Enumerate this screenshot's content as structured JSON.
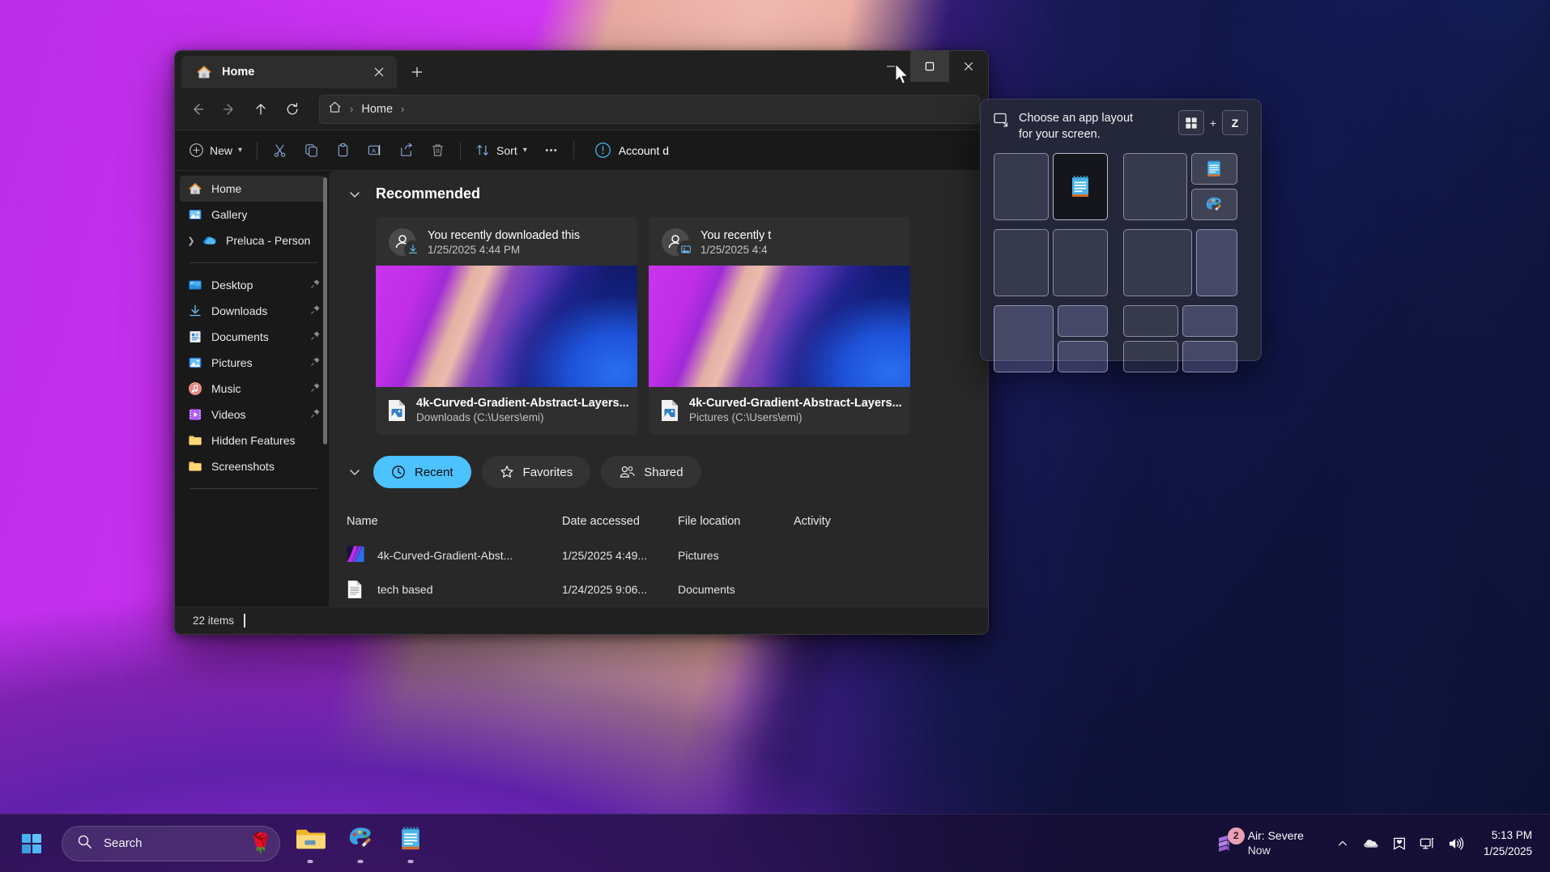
{
  "window": {
    "tab": {
      "label": "Home",
      "icon": "home-icon",
      "close_icon": "close-icon"
    },
    "new_tab_icon": "plus-icon",
    "controls": {
      "minimize": "minimize-icon",
      "maximize": "maximize-icon",
      "close": "close-icon"
    }
  },
  "address": {
    "back_icon": "arrow-left-icon",
    "forward_icon": "arrow-right-icon",
    "up_icon": "arrow-up-icon",
    "refresh_icon": "refresh-icon",
    "home_icon": "home-outline-icon",
    "crumb": "Home",
    "sep": "›"
  },
  "toolbar": {
    "new_label": "New",
    "new_icon": "plus-circle-icon",
    "cut_icon": "scissors-icon",
    "copy_icon": "copy-icon",
    "paste_icon": "clipboard-icon",
    "rename_icon": "rename-icon",
    "share_icon": "share-icon",
    "delete_icon": "trash-icon",
    "sort_label": "Sort",
    "sort_icon": "sort-icon",
    "more_icon": "ellipsis-icon",
    "account_label": "Account d",
    "account_icon": "alert-circle-icon",
    "chevron": "ˇ"
  },
  "sidebar": {
    "items": [
      {
        "label": "Home",
        "icon": "home-icon",
        "selected": true,
        "pinned": false,
        "expandable": false
      },
      {
        "label": "Gallery",
        "icon": "gallery-icon",
        "selected": false,
        "pinned": false,
        "expandable": false
      },
      {
        "label": "Preluca - Person",
        "icon": "onedrive-icon",
        "selected": false,
        "pinned": false,
        "expandable": true
      }
    ],
    "folders": [
      {
        "label": "Desktop",
        "icon": "desktop-icon",
        "pinned": true
      },
      {
        "label": "Downloads",
        "icon": "download-icon",
        "pinned": true
      },
      {
        "label": "Documents",
        "icon": "documents-icon",
        "pinned": true
      },
      {
        "label": "Pictures",
        "icon": "pictures-icon",
        "pinned": true
      },
      {
        "label": "Music",
        "icon": "music-icon",
        "pinned": true
      },
      {
        "label": "Videos",
        "icon": "videos-icon",
        "pinned": true
      },
      {
        "label": "Hidden Features",
        "icon": "folder-icon",
        "pinned": false
      },
      {
        "label": "Screenshots",
        "icon": "folder-icon",
        "pinned": false
      }
    ],
    "pin_icon": "pin-icon"
  },
  "recommended": {
    "title": "Recommended",
    "chevron": "⌄",
    "cards": [
      {
        "headline": "You recently downloaded this",
        "timestamp": "1/25/2025 4:44 PM",
        "filename": "4k-Curved-Gradient-Abstract-Layers...",
        "location": "Downloads (C:\\Users\\emi)",
        "badge_icon": "download-icon",
        "avatar_icon": "person-icon",
        "file_icon": "image-file-icon"
      },
      {
        "headline": "You recently t",
        "timestamp": "1/25/2025 4:4",
        "filename": "4k-Curved-Gradient-Abstract-Layers...",
        "location": "Pictures (C:\\Users\\emi)",
        "badge_icon": "image-icon",
        "avatar_icon": "person-icon",
        "file_icon": "image-file-icon"
      }
    ]
  },
  "quickaccess": {
    "chevron": "⌄",
    "tabs": [
      {
        "label": "Recent",
        "icon": "clock-icon",
        "active": true
      },
      {
        "label": "Favorites",
        "icon": "star-icon",
        "active": false
      },
      {
        "label": "Shared",
        "icon": "people-icon",
        "active": false
      }
    ],
    "columns": [
      "Name",
      "Date accessed",
      "File location",
      "Activity"
    ],
    "rows": [
      {
        "name": "4k-Curved-Gradient-Abst...",
        "date": "1/25/2025 4:49...",
        "location": "Pictures",
        "activity": "",
        "icon": "gradient-thumb-icon"
      },
      {
        "name": "tech based",
        "date": "1/24/2025 9:06...",
        "location": "Documents",
        "activity": "",
        "icon": "text-file-icon"
      }
    ]
  },
  "statusbar": {
    "items_count": "22 items"
  },
  "snap_layout": {
    "icon": "snap-layout-icon",
    "text_line1": "Choose an app layout",
    "text_line2": "for your screen.",
    "shortcut_key1": "windows-key-icon",
    "shortcut_plus": "+",
    "shortcut_key2": "Z",
    "notepad_icon": "notepad-icon",
    "paint_icon": "paint-icon"
  },
  "taskbar": {
    "start_icon": "windows-start-icon",
    "search": {
      "placeholder": "Search",
      "icon": "search-icon",
      "deco": "🌹"
    },
    "apps": [
      {
        "name": "file-explorer",
        "icon": "folder-icon",
        "running": true
      },
      {
        "name": "paint",
        "icon": "paint-icon",
        "running": true
      },
      {
        "name": "notepad",
        "icon": "notepad-icon",
        "running": true
      }
    ],
    "weather": {
      "title": "Air: Severe",
      "subtitle": "Now",
      "badge": "2",
      "icon": "air-quality-icon"
    },
    "tray": [
      {
        "name": "show-hidden-icons",
        "icon": "chevron-up-icon"
      },
      {
        "name": "onedrive",
        "icon": "cloud-icon"
      },
      {
        "name": "health-monitor",
        "icon": "heart-icon"
      },
      {
        "name": "network",
        "icon": "network-icon"
      },
      {
        "name": "volume",
        "icon": "speaker-icon"
      }
    ],
    "clock": {
      "time": "5:13 PM",
      "date": "1/25/2025"
    }
  },
  "colors": {
    "accent": "#4cc2ff",
    "window_bg": "#202020",
    "content_bg": "#282828",
    "sidebar_bg": "#191919",
    "card_bg": "#2f2f2f",
    "badge_pink": "#e8a0b4"
  }
}
